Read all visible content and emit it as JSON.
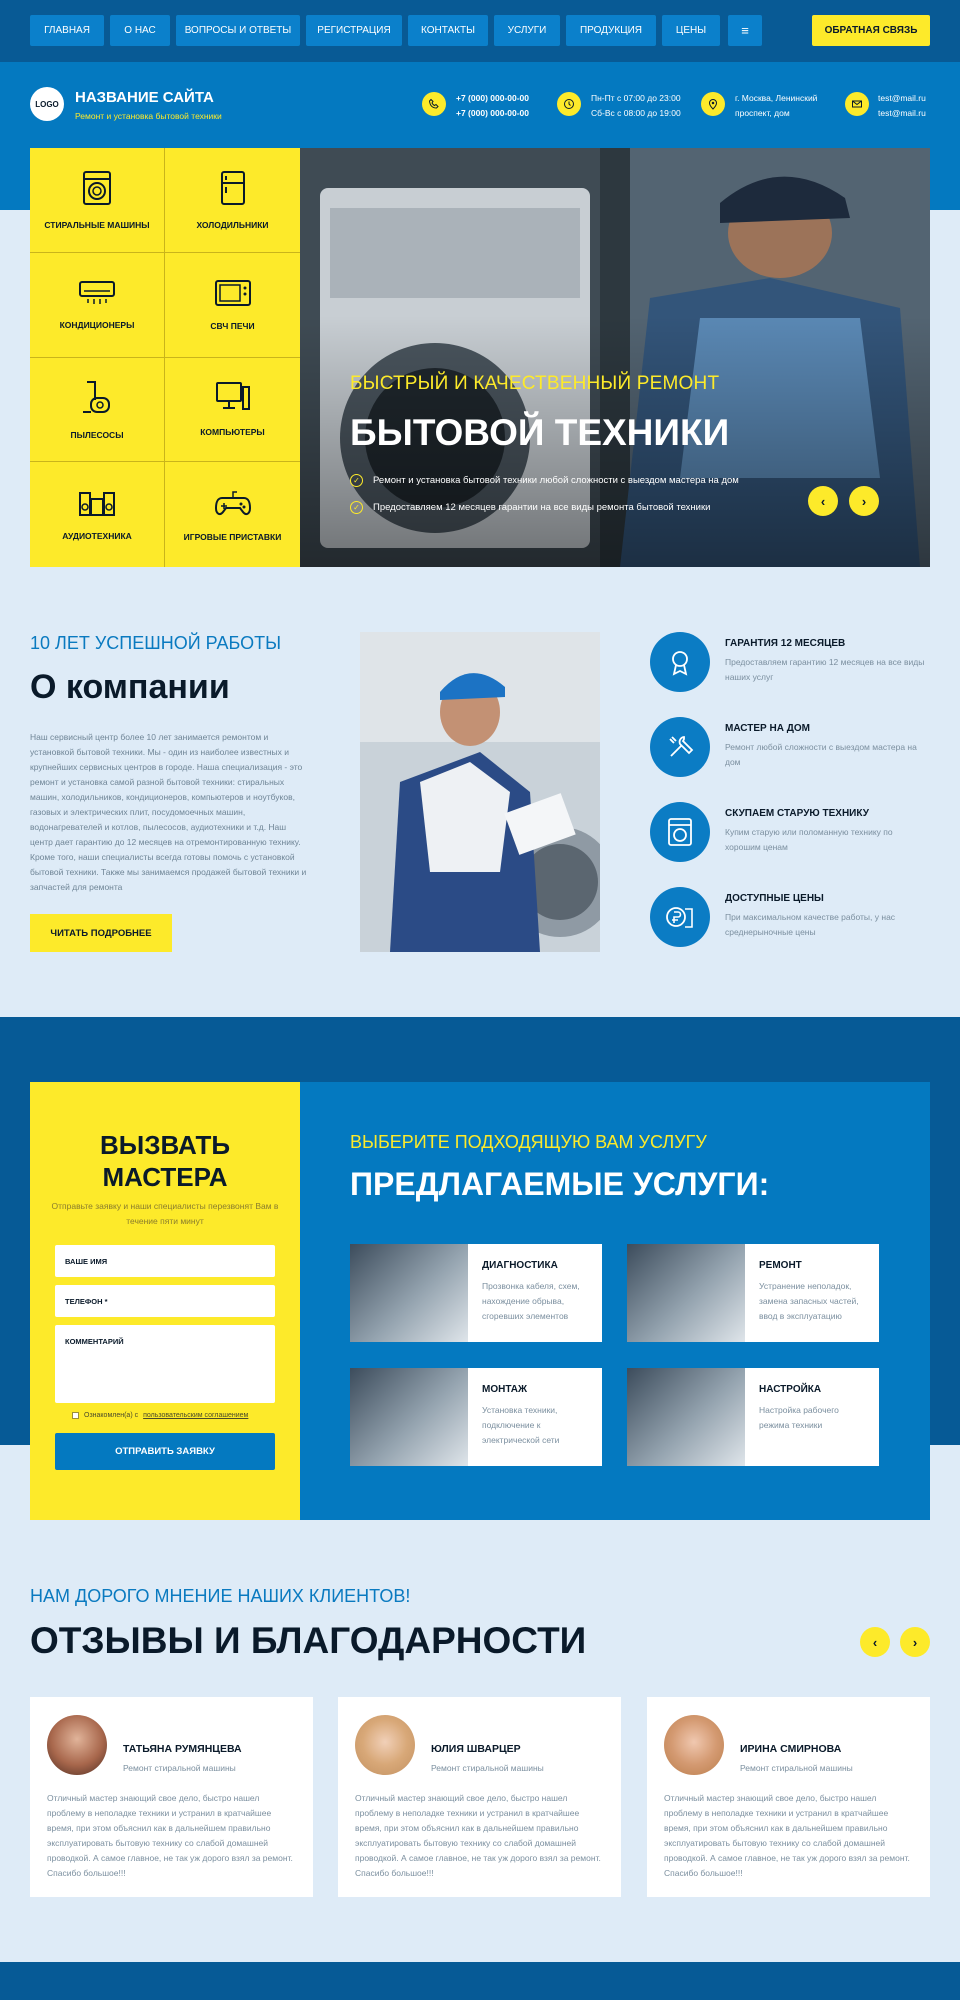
{
  "nav": {
    "items": [
      "ГЛАВНАЯ",
      "О НАС",
      "ВОПРОСЫ И ОТВЕТЫ",
      "РЕГИСТРАЦИЯ",
      "КОНТАКТЫ",
      "УСЛУГИ",
      "ПРОДУКЦИЯ",
      "ЦЕНЫ"
    ],
    "menu_icon": "≡",
    "feedback": "ОБРАТНАЯ СВЯЗЬ"
  },
  "header": {
    "logo": "LOGO",
    "title": "НАЗВАНИЕ САЙТА",
    "subtitle": "Ремонт и установка бытовой техники",
    "phone1": "+7 (000) 000-00-00",
    "phone2": "+7 (000) 000-00-00",
    "hours1": "Пн-Пт с 07:00 до 23:00",
    "hours2": "Сб-Вс с 08:00 до 19:00",
    "address1": "г. Москва, Ленинский",
    "address2": "проспект, дом",
    "email1": "test@mail.ru",
    "email2": "test@mail.ru"
  },
  "categories": [
    {
      "label": "СТИРАЛЬНЫЕ МАШИНЫ",
      "icon": "washing-machine-icon"
    },
    {
      "label": "ХОЛОДИЛЬНИКИ",
      "icon": "fridge-icon"
    },
    {
      "label": "КОНДИЦИОНЕРЫ",
      "icon": "air-conditioner-icon"
    },
    {
      "label": "СВЧ ПЕЧИ",
      "icon": "microwave-icon"
    },
    {
      "label": "ПЫЛЕСОСЫ",
      "icon": "vacuum-icon"
    },
    {
      "label": "КОМПЬЮТЕРЫ",
      "icon": "computer-icon"
    },
    {
      "label": "АУДИОТЕХНИКА",
      "icon": "speaker-icon"
    },
    {
      "label": "ИГРОВЫЕ ПРИСТАВКИ",
      "icon": "gamepad-icon"
    }
  ],
  "hero": {
    "sup": "БЫСТРЫЙ И КАЧЕСТВЕННЫЙ РЕМОНТ",
    "title": "БЫТОВОЙ ТЕХНИКИ",
    "bullets": [
      "Ремонт и установка бытовой техники любой сложности с выездом мастера на дом",
      "Предоставляем 12 месяцев гарантии на все виды ремонта бытовой техники"
    ],
    "prev": "‹",
    "next": "›"
  },
  "about": {
    "sup": "10 ЛЕТ УСПЕШНОЙ РАБОТЫ",
    "title": "О компании",
    "text": "Наш сервисный центр более 10 лет занимается ремонтом и установкой бытовой техники. Мы - один из наиболее известных и крупнейших сервисных центров в городе. Наша специализация - это ремонт и установка самой разной бытовой техники: стиральных машин, холодильников, кондиционеров, компьютеров и ноутбуков, газовых и электрических плит, посудомоечных машин, водонагревателей и котлов, пылесосов, аудиотехники и т.д. Наш центр дает гарантию до 12 месяцев на отремонтированную технику. Кроме того, наши специалисты всегда готовы помочь с установкой бытовой техники. Также мы занимаемся продажей бытовой техники и запчастей для ремонта",
    "button": "ЧИТАТЬ ПОДРОБНЕЕ"
  },
  "features": [
    {
      "title": "ГАРАНТИЯ 12 МЕСЯЦЕВ",
      "desc": "Предоставляем гарантию 12 месяцев на все виды наших услуг",
      "icon": "award-icon"
    },
    {
      "title": "МАСТЕР НА ДОМ",
      "desc": "Ремонт любой сложности с выездом мастера на дом",
      "icon": "tools-icon"
    },
    {
      "title": "СКУПАЕМ СТАРУЮ ТЕХНИКУ",
      "desc": "Купим старую или поломанную технику по хорошим ценам",
      "icon": "washer-icon"
    },
    {
      "title": "ДОСТУПНЫЕ ЦЕНЫ",
      "desc": "При максимальном качестве работы, у нас среднерыночные цены",
      "icon": "coins-icon"
    }
  ],
  "order_form": {
    "title1": "ВЫЗВАТЬ",
    "title2": "МАСТЕРА",
    "subtitle": "Отправьте заявку и наши специалисты перезвонят Вам в течение пяти минут",
    "name_placeholder": "ВАШЕ ИМЯ",
    "phone_placeholder": "ТЕЛЕФОН *",
    "comment_placeholder": "КОММЕНТАРИЙ",
    "consent_prefix": "Ознакомлен(а) с",
    "consent_link": "пользовательским соглашением",
    "submit": "ОТПРАВИТЬ ЗАЯВКУ"
  },
  "services": {
    "sup": "ВЫБЕРИТЕ ПОДХОДЯЩУЮ ВАМ УСЛУГУ",
    "title": "ПРЕДЛАГАЕМЫЕ УСЛУГИ:",
    "items": [
      {
        "name": "ДИАГНОСТИКА",
        "desc": "Прозвонка кабеля, схем, нахождение обрыва, сгоревших элементов"
      },
      {
        "name": "РЕМОНТ",
        "desc": "Устранение неполадок, замена запасных частей, ввод в эксплуатацию"
      },
      {
        "name": "МОНТАЖ",
        "desc": "Установка техники, подключение к электрической сети"
      },
      {
        "name": "НАСТРОЙКА",
        "desc": "Настройка рабочего режима техники"
      }
    ]
  },
  "reviews": {
    "sup": "НАМ ДОРОГО МНЕНИЕ НАШИХ КЛИЕНТОВ!",
    "title": "ОТЗЫВЫ И БЛАГОДАРНОСТИ",
    "prev": "‹",
    "next": "›",
    "items": [
      {
        "name": "ТАТЬЯНА РУМЯНЦЕВА",
        "role": "Ремонт стиральной машины",
        "text": "Отличный мастер знающий свое дело, быстро нашел проблему в неполадке техники и устранил в кратчайшее время, при этом объяснил как в дальнейшем правильно эксплуатировать бытовую технику со слабой домашней проводкой. А самое главное, не так уж дорого взял за ремонт. Спасибо большое!!!"
      },
      {
        "name": "ЮЛИЯ ШВАРЦЕР",
        "role": "Ремонт стиральной машины",
        "text": "Отличный мастер знающий свое дело, быстро нашел проблему в неполадке техники и устранил в кратчайшее время, при этом объяснил как в дальнейшем правильно эксплуатировать бытовую технику со слабой домашней проводкой. А самое главное, не так уж дорого взял за ремонт. Спасибо большое!!!"
      },
      {
        "name": "ИРИНА СМИРНОВА",
        "role": "Ремонт стиральной машины",
        "text": "Отличный мастер знающий свое дело, быстро нашел проблему в неполадке техники и устранил в кратчайшее время, при этом объяснил как в дальнейшем правильно эксплуатировать бытовую технику со слабой домашней проводкой. А самое главное, не так уж дорого взял за ремонт. Спасибо большое!!!"
      }
    ]
  },
  "colors": {
    "primary": "#0479c0",
    "dark": "#065a96",
    "accent": "#fdea2a",
    "background": "#deebf7"
  }
}
